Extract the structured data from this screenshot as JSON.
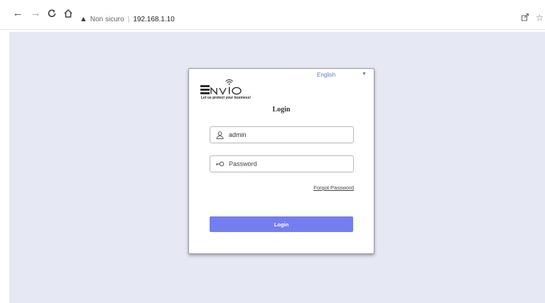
{
  "browser": {
    "security_label": "Non sicuro",
    "separator": "|",
    "url": "192.168.1.10"
  },
  "login_card": {
    "language": "English",
    "brand_tagline": "Let us protect your business!",
    "title": "Login",
    "username_value": "admin",
    "password_placeholder": "Password",
    "forgot_password": "Forgot Password",
    "login_button": "Login",
    "accent_color": "#747ef2",
    "link_color": "#5b7bd0"
  },
  "page_background": "#e6e9f3"
}
